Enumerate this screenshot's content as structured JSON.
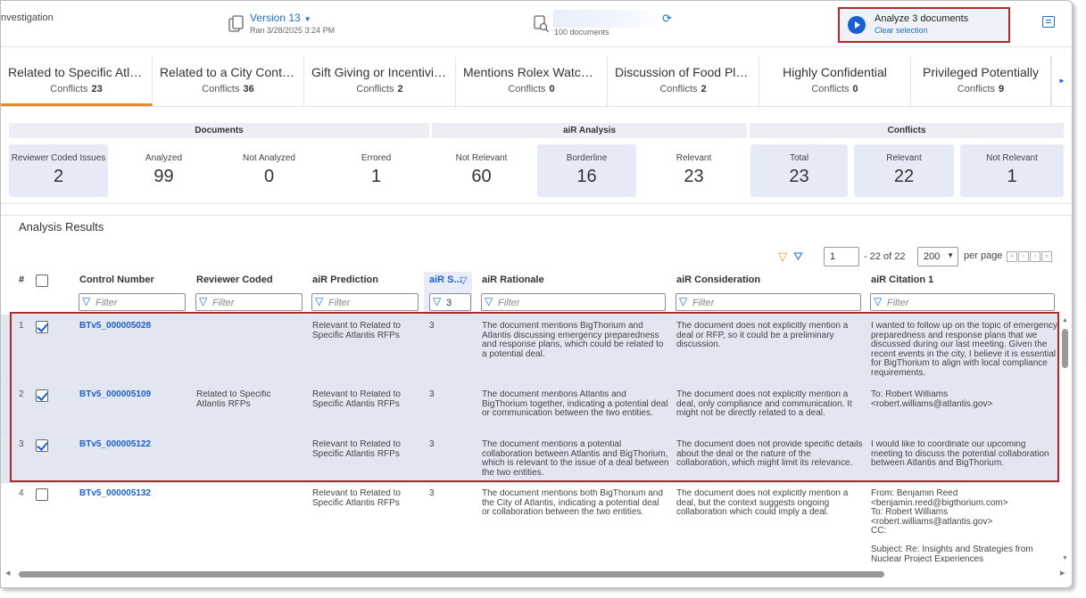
{
  "app": {
    "title": "nvestigation"
  },
  "version": {
    "name": "Version 13",
    "ran": "Ran 3/28/2025 3:24 PM"
  },
  "docset": {
    "count": "100 documents"
  },
  "analyze": {
    "label": "Analyze 3 documents",
    "clear": "Clear selection"
  },
  "tabs": [
    {
      "name": "Related to Specific Atla...",
      "conflicts_label": "Conflicts",
      "conflicts": "23"
    },
    {
      "name": "Related to a City Contra...",
      "conflicts_label": "Conflicts",
      "conflicts": "36"
    },
    {
      "name": "Gift Giving or Incentiviz...",
      "conflicts_label": "Conflicts",
      "conflicts": "2"
    },
    {
      "name": "Mentions Rolex Watches",
      "conflicts_label": "Conflicts",
      "conflicts": "0"
    },
    {
      "name": "Discussion of Food Pla...",
      "conflicts_label": "Conflicts",
      "conflicts": "2"
    },
    {
      "name": "Highly Confidential",
      "conflicts_label": "Conflicts",
      "conflicts": "0"
    },
    {
      "name": "Privileged Potentially",
      "conflicts_label": "Conflicts",
      "conflicts": "9"
    }
  ],
  "stats": {
    "groups": [
      "Documents",
      "aiR Analysis",
      "Conflicts"
    ],
    "items": [
      {
        "label": "Reviewer Coded Issues",
        "value": "2"
      },
      {
        "label": "Analyzed",
        "value": "99"
      },
      {
        "label": "Not Analyzed",
        "value": "0"
      },
      {
        "label": "Errored",
        "value": "1"
      },
      {
        "label": "Not Relevant",
        "value": "60"
      },
      {
        "label": "Borderline",
        "value": "16"
      },
      {
        "label": "Relevant",
        "value": "23"
      },
      {
        "label": "Total",
        "value": "23"
      },
      {
        "label": "Relevant",
        "value": "22"
      },
      {
        "label": "Not Relevant",
        "value": "1"
      }
    ]
  },
  "results": {
    "title": "Analysis Results"
  },
  "pager": {
    "page": "1",
    "range": "- 22 of 22",
    "page_size": "200",
    "per_page": "per page"
  },
  "table": {
    "columns": [
      "#",
      "Control Number",
      "Reviewer Coded",
      "aiR Prediction",
      "aiR S...",
      "aiR Rationale",
      "aiR Consideration",
      "aiR Citation 1"
    ],
    "filter_placeholder": "Filter",
    "score_filter": "3",
    "rows": [
      {
        "num": "1",
        "control": "BTv5_000005028",
        "reviewer": "",
        "prediction": "Relevant to Related to Specific Atlantis RFPs",
        "score": "3",
        "rationale": "The document mentions BigThorium and Atlantis discussing emergency preparedness and response plans, which could be related to a potential deal.",
        "consideration": "The document does not explicitly mention a deal or RFP, so it could be a preliminary discussion.",
        "citation": "I wanted to follow up on the topic of emergency preparedness and response plans that we discussed during our last meeting. Given the recent events in the city, I believe it is essential for BigThorium to align with local compliance requirements."
      },
      {
        "num": "2",
        "control": "BTv5_000005109",
        "reviewer": "Related to Specific Atlantis RFPs",
        "prediction": "Relevant to Related to Specific Atlantis RFPs",
        "score": "3",
        "rationale": "The document mentions Atlantis and BigThorium together, indicating a potential deal or communication between the two entities.",
        "consideration": "The document does not explicitly mention a deal, only compliance and communication. It might not be directly related to a deal.",
        "citation": "To: Robert Williams <robert.williams@atlantis.gov>"
      },
      {
        "num": "3",
        "control": "BTv5_000005122",
        "reviewer": "",
        "prediction": "Relevant to Related to Specific Atlantis RFPs",
        "score": "3",
        "rationale": "The document mentions a potential collaboration between Atlantis and BigThorium, which is relevant to the issue of a deal between the two entities.",
        "consideration": "The document does not provide specific details about the deal or the nature of the collaboration, which might limit its relevance.",
        "citation": "I would like to coordinate our upcoming meeting to discuss the potential collaboration between Atlantis and BigThorium."
      },
      {
        "num": "4",
        "control": "BTv5_000005132",
        "reviewer": "",
        "prediction": "Relevant to Related to Specific Atlantis RFPs",
        "score": "3",
        "rationale": "The document mentions both BigThorium and the City of Atlantis, indicating a potential deal or collaboration between the two entities.",
        "consideration": "The document does not explicitly mention a deal, but the context suggests ongoing collaboration which could imply a deal.",
        "citation": "From: Benjamin Reed <benjamin.reed@bigthorium.com>\nTo: Robert Williams <robert.williams@atlantis.gov>\nCC:\n\nSubject: Re: Insights and Strategies from Nuclear Project Experiences"
      }
    ]
  },
  "colors": {
    "accent": "#1a5fd1",
    "highlight_border": "#b3272d",
    "active_tab": "#e8892b",
    "selected_row": "#e1e6f1"
  }
}
